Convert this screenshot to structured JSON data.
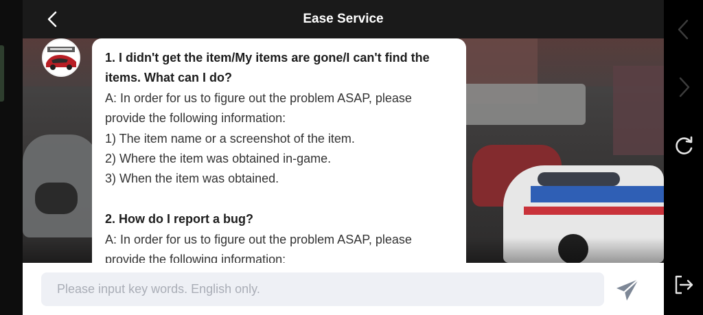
{
  "header": {
    "title": "Ease Service",
    "back_icon": "chevron-left-icon"
  },
  "chat": {
    "avatar_icon": "game-logo-avatar",
    "message": {
      "lines": [
        {
          "text": "1. I didn't get the item/My items are gone/I can't find the",
          "bold": true
        },
        {
          "text": "items. What can I do?",
          "bold": true
        },
        {
          "text": "A: In order for us to figure out the problem ASAP, please",
          "bold": false
        },
        {
          "text": "provide the following information:",
          "bold": false
        },
        {
          "text": "1) The item name or a screenshot of the item.",
          "bold": false
        },
        {
          "text": "2) Where the item was obtained in-game.",
          "bold": false
        },
        {
          "text": "3) When the item was obtained.",
          "bold": false
        },
        {
          "text": "",
          "bold": false
        },
        {
          "text": "2. How do I report a bug?",
          "bold": true
        },
        {
          "text": "A: In order for us to figure out the problem ASAP, please",
          "bold": false
        },
        {
          "text": "provide the following information:",
          "bold": false
        }
      ]
    }
  },
  "input": {
    "value": "",
    "placeholder": "Please input key words. English only.",
    "send_icon": "send-icon"
  },
  "browser_nav": {
    "back_icon": "chevron-left-icon",
    "forward_icon": "chevron-right-icon",
    "reload_icon": "reload-icon",
    "exit_icon": "exit-icon"
  },
  "colors": {
    "header_bg": "#1a1a1a",
    "bubble_bg": "#ffffff",
    "input_bg": "#eef0f5",
    "placeholder": "#a9adb6",
    "send_icon": "#7d8796",
    "nav_icon_active": "#e6e6e6",
    "nav_icon_disabled": "#3c3c3c"
  }
}
